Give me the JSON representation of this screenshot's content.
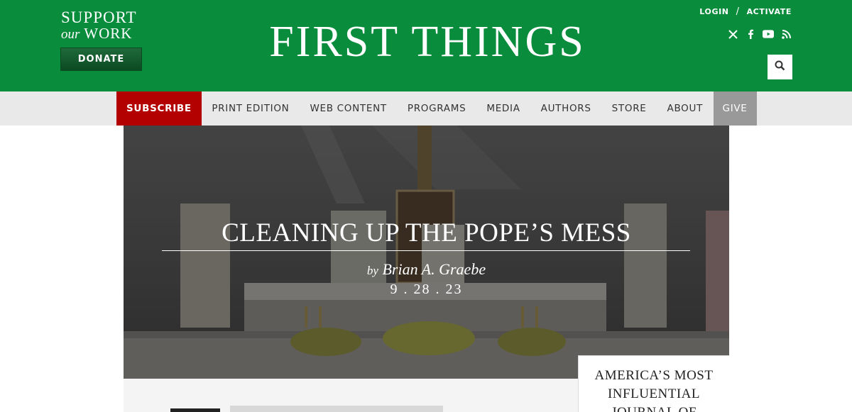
{
  "header": {
    "support_line1": "SUPPORT",
    "support_our": "our",
    "support_work": "WORK",
    "donate_label": "DONATE",
    "logo": "FIRST THINGS",
    "login_label": "LOGIN",
    "account_separator": "/",
    "activate_label": "ACTIVATE",
    "social": [
      "x-icon",
      "facebook-icon",
      "youtube-icon",
      "rss-icon"
    ],
    "brand_color": "#0a8c3d"
  },
  "nav": {
    "items": [
      {
        "label": "SUBSCRIBE"
      },
      {
        "label": "PRINT EDITION"
      },
      {
        "label": "WEB CONTENT"
      },
      {
        "label": "PROGRAMS"
      },
      {
        "label": "MEDIA"
      },
      {
        "label": "AUTHORS"
      },
      {
        "label": "STORE"
      },
      {
        "label": "ABOUT"
      },
      {
        "label": "GIVE"
      }
    ],
    "subscribe_color": "#b30000",
    "give_color": "#999999"
  },
  "hero": {
    "title": "CLEANING UP THE POPE’S MESS",
    "by": "by",
    "author": "Brian A. Graebe",
    "date": "9 . 28 . 23"
  },
  "promo": {
    "line1": "AMERICA’S MOST",
    "line2": "INFLUENTIAL",
    "line3": "JOURNAL OF"
  }
}
